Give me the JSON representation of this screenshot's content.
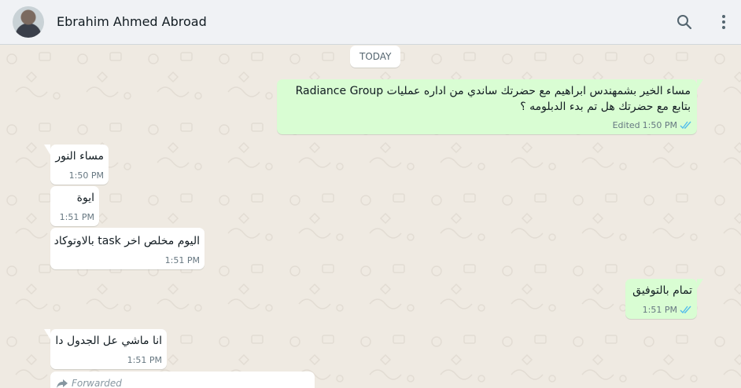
{
  "header": {
    "contact_name": "Ebrahim Ahmed Abroad"
  },
  "date_divider": "TODAY",
  "messages": [
    {
      "direction": "out",
      "line1": "مساء الخير بشمهندس ابراهيم مع حضرتك ساندي من اداره عمليات Radiance Group",
      "line2": "بتابع مع حضرتك هل تم بدء الدبلومه ؟",
      "edited": "Edited",
      "time": "1:50 PM",
      "status": "read"
    },
    {
      "direction": "in",
      "text": "مساء النور",
      "time": "1:50 PM"
    },
    {
      "direction": "in",
      "text": "ايوة",
      "time": "1:51 PM"
    },
    {
      "direction": "in",
      "text": "اليوم مخلص اخر task بالاوتوكاد",
      "time": "1:51 PM"
    },
    {
      "direction": "out",
      "text": "تمام بالتوفيق",
      "time": "1:51 PM",
      "status": "read"
    },
    {
      "direction": "in",
      "text": "انا ماشي عل  الجدول دا",
      "time": "1:51 PM"
    },
    {
      "direction": "in",
      "forwarded_label": "Forwarded"
    }
  ],
  "colors": {
    "outgoing_bubble": "#d9fdd3",
    "incoming_bubble": "#ffffff",
    "read_ticks": "#53bdeb",
    "chat_background": "#efeae2"
  }
}
